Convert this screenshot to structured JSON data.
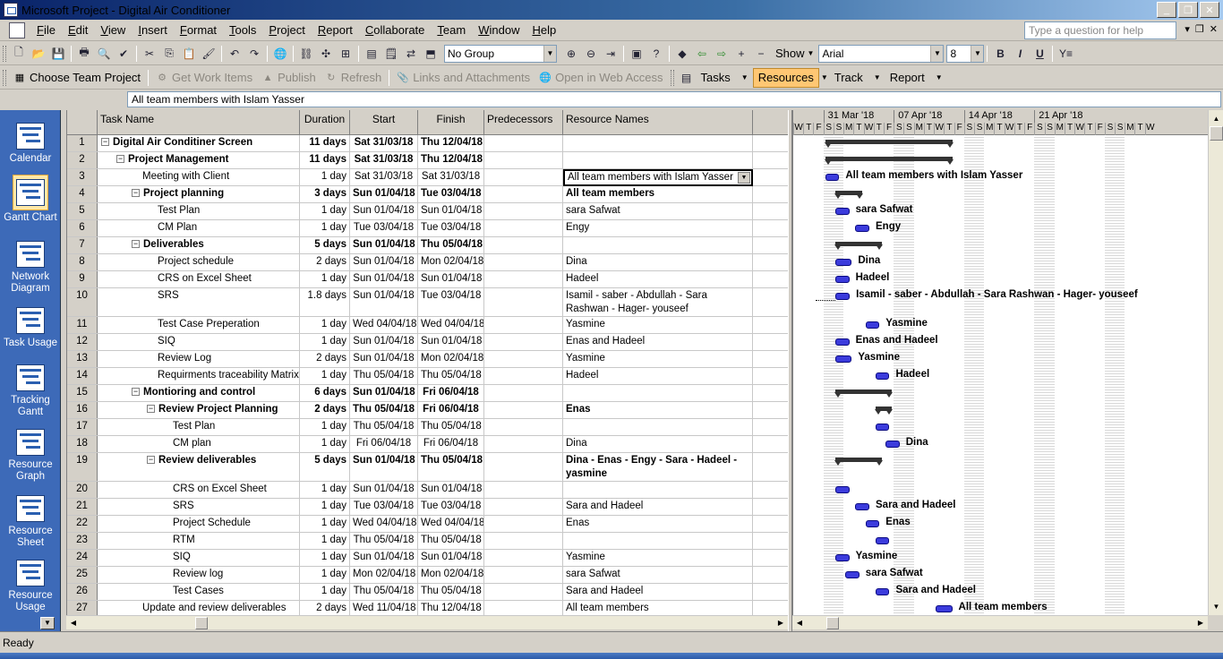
{
  "window": {
    "title": "Microsoft Project - Digital Air Conditioner"
  },
  "menu": [
    "File",
    "Edit",
    "View",
    "Insert",
    "Format",
    "Tools",
    "Project",
    "Report",
    "Collaborate",
    "Team",
    "Window",
    "Help"
  ],
  "help_box": {
    "placeholder": "Type a question for help"
  },
  "toolbar1": {
    "group_value": "No Group",
    "show_label": "Show",
    "font_value": "Arial",
    "size_value": "8"
  },
  "toolbar2": {
    "choose_team_project": "Choose Team Project",
    "get_work_items": "Get Work Items",
    "publish": "Publish",
    "refresh": "Refresh",
    "links_attachments": "Links and Attachments",
    "open_web": "Open in Web Access",
    "tasks": "Tasks",
    "resources": "Resources",
    "track": "Track",
    "report": "Report"
  },
  "entry_bar": {
    "value": "All team members with Islam Yasser"
  },
  "view_bar": [
    {
      "label": "Calendar",
      "icon": "calendar-icon"
    },
    {
      "label": "Gantt Chart",
      "icon": "gantt-chart-icon"
    },
    {
      "label": "Network Diagram",
      "icon": "network-diagram-icon"
    },
    {
      "label": "Task Usage",
      "icon": "task-usage-icon"
    },
    {
      "label": "Tracking Gantt",
      "icon": "tracking-gantt-icon"
    },
    {
      "label": "Resource Graph",
      "icon": "resource-graph-icon"
    },
    {
      "label": "Resource Sheet",
      "icon": "resource-sheet-icon"
    },
    {
      "label": "Resource Usage",
      "icon": "resource-usage-icon"
    }
  ],
  "table": {
    "columns": [
      "Task Name",
      "Duration",
      "Start",
      "Finish",
      "Predecessors",
      "Resource Names"
    ],
    "rows": [
      {
        "id": "1",
        "name": "Digital Air Conditiner Screen",
        "duration": "11 days",
        "start": "Sat 31/03/18",
        "finish": "Thu 12/04/18",
        "pred": "",
        "res": ""
      },
      {
        "id": "2",
        "name": "Project Management",
        "duration": "11 days",
        "start": "Sat 31/03/18",
        "finish": "Thu 12/04/18",
        "pred": "",
        "res": ""
      },
      {
        "id": "3",
        "name": "Meeting with Client",
        "duration": "1 day",
        "start": "Sat 31/03/18",
        "finish": "Sat 31/03/18",
        "pred": "",
        "res": "All team members with Islam Yasser"
      },
      {
        "id": "4",
        "name": "Project planning",
        "duration": "3 days",
        "start": "Sun 01/04/18",
        "finish": "Tue 03/04/18",
        "pred": "",
        "res": "All team members"
      },
      {
        "id": "5",
        "name": "Test Plan",
        "duration": "1 day",
        "start": "Sun 01/04/18",
        "finish": "Sun 01/04/18",
        "pred": "",
        "res": "sara Safwat"
      },
      {
        "id": "6",
        "name": "CM Plan",
        "duration": "1 day",
        "start": "Tue 03/04/18",
        "finish": "Tue 03/04/18",
        "pred": "",
        "res": "Engy"
      },
      {
        "id": "7",
        "name": "Deliverables",
        "duration": "5 days",
        "start": "Sun 01/04/18",
        "finish": "Thu 05/04/18",
        "pred": "",
        "res": ""
      },
      {
        "id": "8",
        "name": "Project schedule",
        "duration": "2 days",
        "start": "Sun 01/04/18",
        "finish": "Mon 02/04/18",
        "pred": "",
        "res": "Dina"
      },
      {
        "id": "9",
        "name": "CRS on Excel Sheet",
        "duration": "1 day",
        "start": "Sun 01/04/18",
        "finish": "Sun 01/04/18",
        "pred": "",
        "res": "Hadeel"
      },
      {
        "id": "10",
        "name": "SRS",
        "duration": "1.8 days",
        "start": "Sun 01/04/18",
        "finish": "Tue 03/04/18",
        "pred": "",
        "res": "Isamil - saber - Abdullah - Sara Rashwan - Hager- youseef"
      },
      {
        "id": "11",
        "name": "Test Case Preperation",
        "duration": "1 day",
        "start": "Wed 04/04/18",
        "finish": "Wed 04/04/18",
        "pred": "",
        "res": "Yasmine"
      },
      {
        "id": "12",
        "name": "SIQ",
        "duration": "1 day",
        "start": "Sun 01/04/18",
        "finish": "Sun 01/04/18",
        "pred": "",
        "res": "Enas and Hadeel"
      },
      {
        "id": "13",
        "name": "Review Log",
        "duration": "2 days",
        "start": "Sun 01/04/18",
        "finish": "Mon 02/04/18",
        "pred": "",
        "res": "Yasmine"
      },
      {
        "id": "14",
        "name": "Requirments traceability Matrix",
        "duration": "1 day",
        "start": "Thu 05/04/18",
        "finish": "Thu 05/04/18",
        "pred": "",
        "res": "Hadeel"
      },
      {
        "id": "15",
        "name": "Montioring and control",
        "duration": "6 days",
        "start": "Sun 01/04/18",
        "finish": "Fri 06/04/18",
        "pred": "",
        "res": ""
      },
      {
        "id": "16",
        "name": "Review  Project Planning",
        "duration": "2 days",
        "start": "Thu 05/04/18",
        "finish": "Fri 06/04/18",
        "pred": "",
        "res": "Enas"
      },
      {
        "id": "17",
        "name": "Test Plan",
        "duration": "1 day",
        "start": "Thu 05/04/18",
        "finish": "Thu 05/04/18",
        "pred": "",
        "res": ""
      },
      {
        "id": "18",
        "name": "CM plan",
        "duration": "1 day",
        "start": "Fri 06/04/18",
        "finish": "Fri 06/04/18",
        "pred": "",
        "res": "Dina"
      },
      {
        "id": "19",
        "name": "Review deliverables",
        "duration": "5 days",
        "start": "Sun 01/04/18",
        "finish": "Thu 05/04/18",
        "pred": "",
        "res": "Dina - Enas - Engy - Sara - Hadeel - yasmine"
      },
      {
        "id": "20",
        "name": "CRS on Excel Sheet",
        "duration": "1 day",
        "start": "Sun 01/04/18",
        "finish": "Sun 01/04/18",
        "pred": "",
        "res": ""
      },
      {
        "id": "21",
        "name": "SRS",
        "duration": "1 day",
        "start": "Tue 03/04/18",
        "finish": "Tue 03/04/18",
        "pred": "",
        "res": "Sara and Hadeel"
      },
      {
        "id": "22",
        "name": "Project Schedule",
        "duration": "1 day",
        "start": "Wed 04/04/18",
        "finish": "Wed 04/04/18",
        "pred": "",
        "res": "Enas"
      },
      {
        "id": "23",
        "name": "RTM",
        "duration": "1 day",
        "start": "Thu 05/04/18",
        "finish": "Thu 05/04/18",
        "pred": "",
        "res": ""
      },
      {
        "id": "24",
        "name": "SIQ",
        "duration": "1 day",
        "start": "Sun 01/04/18",
        "finish": "Sun 01/04/18",
        "pred": "",
        "res": "Yasmine"
      },
      {
        "id": "25",
        "name": "Review log",
        "duration": "1 day",
        "start": "Mon 02/04/18",
        "finish": "Mon 02/04/18",
        "pred": "",
        "res": "sara Safwat"
      },
      {
        "id": "26",
        "name": "Test Cases",
        "duration": "1 day",
        "start": "Thu 05/04/18",
        "finish": "Thu 05/04/18",
        "pred": "",
        "res": "Sara and Hadeel"
      },
      {
        "id": "27",
        "name": "Update and review deliverables",
        "duration": "2 days",
        "start": "Wed 11/04/18",
        "finish": "Thu 12/04/18",
        "pred": "",
        "res": "All team members"
      }
    ]
  },
  "gantt": {
    "weeks": [
      "31 Mar '18",
      "07 Apr '18",
      "14 Apr '18",
      "21 Apr '18"
    ],
    "day_letters": [
      "W",
      "T",
      "F",
      "S",
      "S",
      "M",
      "T",
      "W",
      "T",
      "F",
      "S",
      "S",
      "M",
      "T",
      "W",
      "T",
      "F",
      "S",
      "S",
      "M",
      "T",
      "W",
      "T",
      "F",
      "S",
      "S",
      "M",
      "T",
      "W",
      "T",
      "F",
      "S",
      "S",
      "M",
      "T",
      "W"
    ],
    "labels": {
      "3": "All team members with Islam Yasser",
      "5": "sara Safwat",
      "6": "Engy",
      "8": "Dina",
      "9": "Hadeel",
      "10": "Isamil - saber - Abdullah - Sara Rashwan - Hager- youseef",
      "11": "Yasmine",
      "12": "Enas and Hadeel",
      "13": "Yasmine",
      "14": "Hadeel",
      "18": "Dina",
      "21": "Sara and Hadeel",
      "22": "Enas",
      "24": "Yasmine",
      "25": "sara Safwat",
      "26": "Sara and Hadeel",
      "27": "All team members"
    }
  },
  "status": {
    "text": "Ready"
  }
}
